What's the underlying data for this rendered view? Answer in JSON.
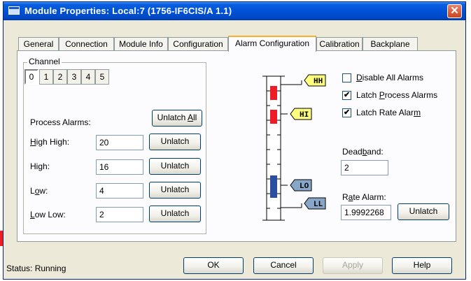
{
  "window": {
    "title": "Module Properties: Local:7 (1756-IF6CIS/A 1.1)",
    "close_label": "✕"
  },
  "tabs": [
    {
      "label": "General",
      "active": false
    },
    {
      "label": "Connection",
      "active": false
    },
    {
      "label": "Module Info",
      "active": false
    },
    {
      "label": "Configuration",
      "active": false
    },
    {
      "label": "Alarm Configuration",
      "active": true
    },
    {
      "label": "Calibration",
      "active": false
    },
    {
      "label": "Backplane",
      "active": false
    }
  ],
  "channel": {
    "legend": "Channel",
    "items": [
      "0",
      "1",
      "2",
      "3",
      "4",
      "5"
    ],
    "selected": "0"
  },
  "process_alarms": {
    "heading": "Process Alarms:",
    "unlatch_all": {
      "pre": "Unlatch ",
      "mnemonic": "A",
      "post": "ll"
    },
    "rows": [
      {
        "label_mnemonic": "H",
        "label_rest": "igh High:",
        "value": "20",
        "button": "Unlatch"
      },
      {
        "label_pre": "Hi",
        "label_mnemonic": "g",
        "label_post": "h:",
        "value": "16",
        "button": "Unlatch"
      },
      {
        "label_pre": "L",
        "label_mnemonic": "o",
        "label_post": "w:",
        "value": "4",
        "button": "Unlatch"
      },
      {
        "label_mnemonic": "L",
        "label_rest": "ow Low:",
        "value": "2",
        "button": "Unlatch"
      }
    ]
  },
  "meter": {
    "tags": {
      "hh": "HH",
      "hi": "HI",
      "lo": "LO",
      "ll": "LL"
    },
    "colors": {
      "tag_yellow": "#ffff80",
      "tag_blue": "#87a6c8",
      "red_bar": "#ee1c24",
      "blue_bar": "#2a4ea0"
    }
  },
  "options": {
    "disable_all_alarms": {
      "pre": "",
      "mnemonic": "D",
      "post": "isable All Alarms",
      "checked": false
    },
    "latch_process_alarms": {
      "pre": "Latch ",
      "mnemonic": "P",
      "post": "rocess Alarms",
      "checked": true
    },
    "latch_rate_alarm": {
      "pre": "Latch Rate Alar",
      "mnemonic": "m",
      "post": "",
      "checked": true
    }
  },
  "deadband": {
    "label_pre": "Dead",
    "label_mnemonic": "b",
    "label_post": "and:",
    "value": "2"
  },
  "rate_alarm": {
    "label_pre": "R",
    "label_mnemonic": "a",
    "label_post": "te Alarm:",
    "value": "1.9992268",
    "button": "Unlatch"
  },
  "footer": {
    "status": "Status:  Running",
    "ok": "OK",
    "cancel": "Cancel",
    "apply": "Apply",
    "help": "Help"
  }
}
